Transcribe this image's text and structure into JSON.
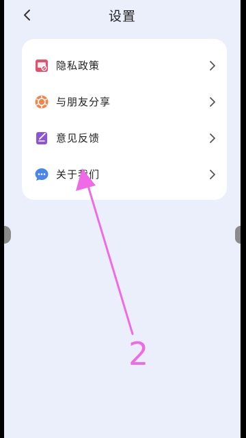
{
  "header": {
    "title": "设置"
  },
  "menu": {
    "items": [
      {
        "label": "隐私政策",
        "icon": "privacy-shield-icon"
      },
      {
        "label": "与朋友分享",
        "icon": "share-aperture-icon"
      },
      {
        "label": "意见反馈",
        "icon": "feedback-edit-icon"
      },
      {
        "label": "关于我们",
        "icon": "chat-bubble-icon"
      }
    ]
  },
  "annotation": {
    "number": "2"
  },
  "colors": {
    "background": "#ebeefb",
    "card": "#ffffff",
    "annotation": "#ef6ae6",
    "privacy_icon": "#e84f6b",
    "share_icon": "#f2864a",
    "feedback_icon": "#8d54d8",
    "about_icon": "#4a86e8"
  }
}
